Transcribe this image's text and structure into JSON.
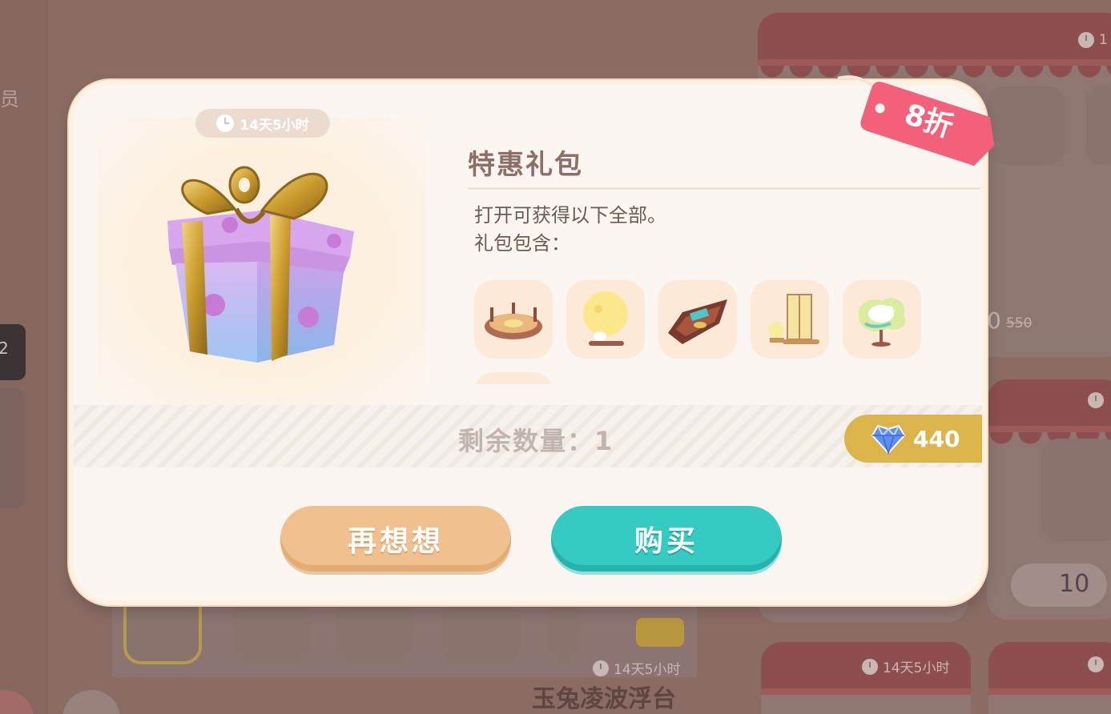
{
  "background": {
    "left_label": "员",
    "left_tab_label": "2",
    "card_timers": [
      "1",
      "14天5小时",
      "1"
    ],
    "strike_price": "550",
    "bottom_timer": "14天5小时",
    "bottom_title": "玉兔凌波浮台",
    "right_price_partial": "10",
    "partial_price_digit": "0"
  },
  "dialog": {
    "timer": "14天5小时",
    "title": "特惠礼包",
    "description_line1": "打开可获得以下全部。",
    "description_line2": "礼包包含：",
    "discount_label": "8折",
    "remaining_label": "剩余数量：1",
    "price": "440",
    "cancel_label": "再想想",
    "buy_label": "购买",
    "items": [
      {
        "icon": "carousel-platform-icon"
      },
      {
        "icon": "moon-rabbit-icon"
      },
      {
        "icon": "wooden-boat-icon"
      },
      {
        "icon": "lantern-screen-icon"
      },
      {
        "icon": "jade-rabbit-tree-icon"
      },
      {
        "icon": "extra-item-icon"
      }
    ]
  },
  "colors": {
    "buy": "#35cbc3",
    "cancel": "#f0c18e",
    "price_tag": "#dcb44c",
    "discount": "#f2607a"
  }
}
